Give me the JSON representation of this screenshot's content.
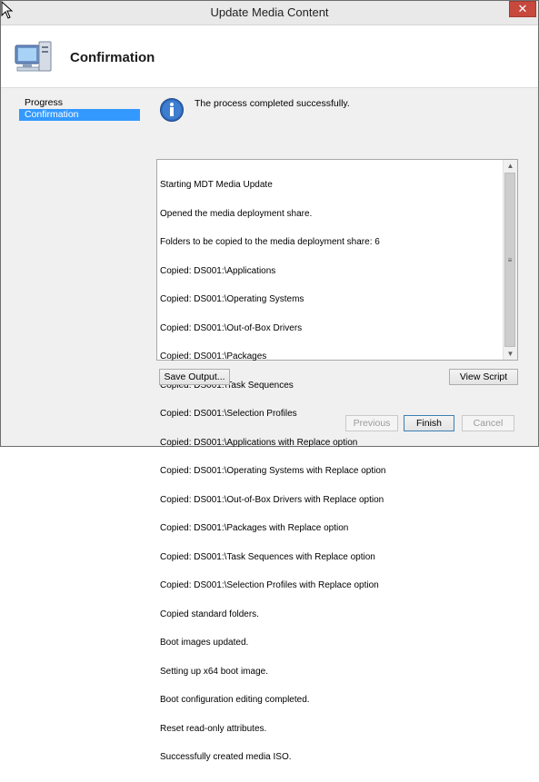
{
  "window": {
    "title": "Update Media Content",
    "close_glyph": "✕"
  },
  "header": {
    "title": "Confirmation",
    "icon": "computer-icon"
  },
  "nav": {
    "items": [
      {
        "label": "Progress",
        "selected": false
      },
      {
        "label": "Confirmation",
        "selected": true
      }
    ]
  },
  "main": {
    "info_icon": "info-icon",
    "status": "The process completed successfully.",
    "output_lines": [
      "Starting MDT Media Update",
      "Opened the media deployment share.",
      "Folders to be copied to the media deployment share: 6",
      "Copied: DS001:\\Applications",
      "Copied: DS001:\\Operating Systems",
      "Copied: DS001:\\Out-of-Box Drivers",
      "Copied: DS001:\\Packages",
      "Copied: DS001:\\Task Sequences",
      "Copied: DS001:\\Selection Profiles",
      "Copied: DS001:\\Applications with Replace option",
      "Copied: DS001:\\Operating Systems with Replace option",
      "Copied: DS001:\\Out-of-Box Drivers with Replace option",
      "Copied: DS001:\\Packages with Replace option",
      "Copied: DS001:\\Task Sequences with Replace option",
      "Copied: DS001:\\Selection Profiles with Replace option",
      "Copied standard folders.",
      "Boot images updated.",
      "Setting up x64 boot image.",
      "Boot configuration editing completed.",
      "Reset read-only attributes.",
      "Successfully created media ISO."
    ],
    "save_output_label": "Save Output...",
    "view_script_label": "View Script"
  },
  "footer": {
    "previous_label": "Previous",
    "finish_label": "Finish",
    "cancel_label": "Cancel"
  }
}
